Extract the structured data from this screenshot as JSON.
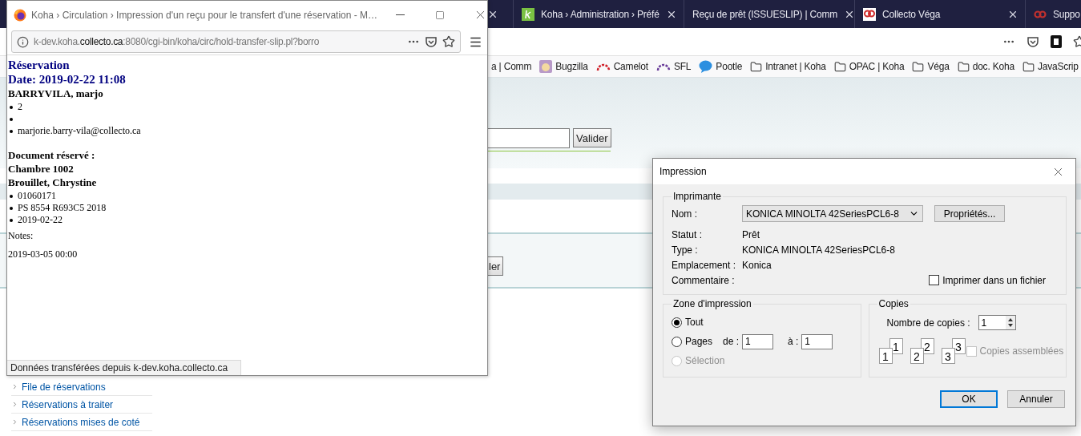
{
  "browser": {
    "tabs": [
      {
        "label": "Koha › Administration › Préfé",
        "kind": "koha",
        "selected": false
      },
      {
        "label": "Reçu de prêt (ISSUESLIP) | Comm",
        "kind": "plain",
        "selected": false
      },
      {
        "label": "Collecto Véga",
        "kind": "collecto",
        "selected": false
      },
      {
        "label": "Suppo",
        "kind": "support",
        "selected": false
      }
    ],
    "bookmarks": [
      {
        "label": "a | Comm",
        "kind": "plain"
      },
      {
        "label": "Bugzilla",
        "kind": "bug"
      },
      {
        "label": "Camelot",
        "kind": "arc",
        "color": "#d0202a"
      },
      {
        "label": "SFL",
        "kind": "arc",
        "color": "#6a3d9a"
      },
      {
        "label": "Pootle",
        "kind": "bubble"
      },
      {
        "label": "Intranet | Koha",
        "kind": "folder"
      },
      {
        "label": "OPAC | Koha",
        "kind": "folder"
      },
      {
        "label": "Véga",
        "kind": "folder"
      },
      {
        "label": "doc. Koha",
        "kind": "folder"
      },
      {
        "label": "JavaScrip",
        "kind": "folder"
      }
    ]
  },
  "page": {
    "search_button": "Valider",
    "cut_button": "ler",
    "sidebar_links": [
      "File de réservations",
      "Réservations à traiter",
      "Réservations mises de coté"
    ]
  },
  "popup": {
    "title": "Koha › Circulation › Impression d'un reçu pour le transfert d'une réservation - M…",
    "url": "k-dev.koha.**collecto.ca**:8080/cgi-bin/koha/circ/hold-transfer-slip.pl?borro",
    "slip": {
      "heading": "Réservation",
      "date": "Date: 2019-02-22 11:08",
      "patron": "BARRYVILA, marjo",
      "patron_details": [
        {
          "kind": "text",
          "text": "2"
        },
        {
          "kind": "empty"
        },
        {
          "kind": "text",
          "text": "marjorie.barry-vila@collecto.ca"
        }
      ],
      "item_heading": "Document réservé :",
      "item_title": "Chambre 1002",
      "item_author": "Brouillet, Chrystine",
      "item_details": [
        "01060171",
        "PS 8554 R693C5 2018",
        "2019-02-22"
      ],
      "notes_label": "Notes:",
      "expiry": "2019-03-05 00:00"
    },
    "status": "Données transférées depuis k-dev.koha.collecto.ca"
  },
  "print_dialog": {
    "title": "Impression",
    "printer": {
      "legend": "Imprimante",
      "name_label": "Nom :",
      "name_value": "KONICA MINOLTA 42SeriesPCL6-8",
      "properties_button": "Propriétés...",
      "info": [
        {
          "label": "Statut :",
          "value": "Prêt"
        },
        {
          "label": "Type :",
          "value": "KONICA MINOLTA 42SeriesPCL6-8"
        },
        {
          "label": "Emplacement :",
          "value": "Konica"
        },
        {
          "label": "Commentaire :"
        }
      ],
      "print_to_file": {
        "label": "Imprimer dans un fichier",
        "checked": false
      }
    },
    "range": {
      "legend": "Zone d'impression",
      "options": [
        {
          "label": "Tout",
          "selected": true,
          "disabled": false
        },
        {
          "label": "Pages",
          "selected": false,
          "disabled": false
        },
        {
          "label": "Sélection",
          "selected": false,
          "disabled": true
        }
      ],
      "from_label": "de :",
      "from_value": "1",
      "to_label": "à :",
      "to_value": "1"
    },
    "copies": {
      "legend": "Copies",
      "count_label": "Nombre de copies :",
      "count_value": "1",
      "collate_pages": [
        {
          "back": "1",
          "front": "1"
        },
        {
          "back": "2",
          "front": "2"
        },
        {
          "back": "3",
          "front": "3"
        }
      ],
      "collate": {
        "label": "Copies assemblées",
        "checked": false,
        "disabled": true
      }
    },
    "buttons": [
      {
        "label": "OK",
        "default": true
      },
      {
        "label": "Annuler",
        "default": false
      }
    ]
  }
}
